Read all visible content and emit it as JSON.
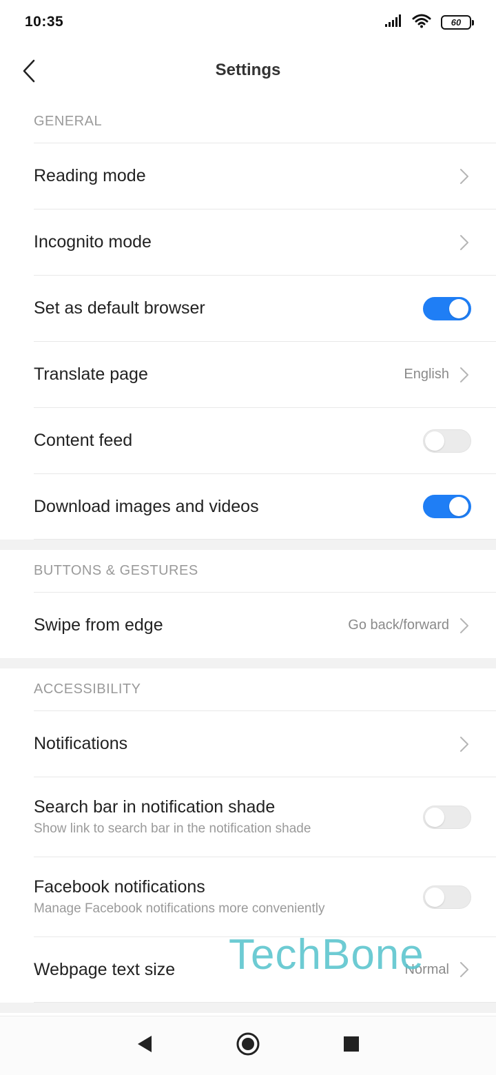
{
  "status_bar": {
    "time": "10:35",
    "battery": "60"
  },
  "header": {
    "title": "Settings"
  },
  "sections": {
    "general": {
      "header": "GENERAL",
      "reading_mode": "Reading mode",
      "incognito_mode": "Incognito mode",
      "default_browser": "Set as default browser",
      "translate_page": "Translate page",
      "translate_value": "English",
      "content_feed": "Content feed",
      "download_media": "Download images and videos"
    },
    "buttons_gestures": {
      "header": "BUTTONS & GESTURES",
      "swipe_from_edge": "Swipe from edge",
      "swipe_value": "Go back/forward"
    },
    "accessibility": {
      "header": "ACCESSIBILITY",
      "notifications": "Notifications",
      "search_bar_title": "Search bar in notification shade",
      "search_bar_sub": "Show link to search bar in the notification shade",
      "facebook_title": "Facebook notifications",
      "facebook_sub": "Manage Facebook notifications more conveniently",
      "text_size": "Webpage text size",
      "text_size_value": "Normal"
    }
  },
  "toggles": {
    "default_browser": true,
    "content_feed": false,
    "download_media": true,
    "search_bar": false,
    "facebook": false
  },
  "watermark": "TechBone",
  "colors": {
    "accent": "#1f7ef5",
    "watermark": "#5ac4cd"
  }
}
